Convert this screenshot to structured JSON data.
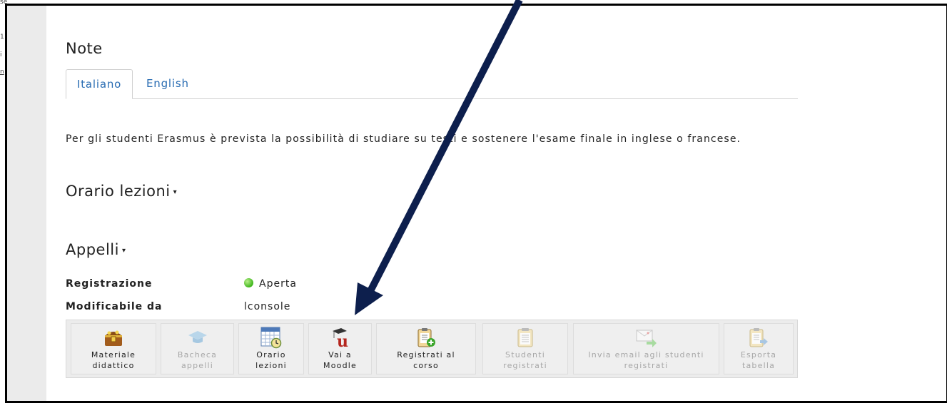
{
  "edge_fragments": [
    "se",
    "1",
    "i",
    "n"
  ],
  "note": {
    "title": "Note",
    "tabs": [
      {
        "label": "Italiano",
        "active": true
      },
      {
        "label": "English",
        "active": false
      }
    ],
    "text": "Per gli studenti Erasmus è prevista la possibilità di studiare su testi e sostenere l'esame finale in inglese o francese."
  },
  "orario": {
    "title": "Orario lezioni",
    "caret": "▾"
  },
  "appelli": {
    "title": "Appelli",
    "caret": "▾",
    "registrazione_label": "Registrazione",
    "registrazione_value": "Aperta",
    "registrazione_status_color": "#3eb51b",
    "modificabile_label": "Modificabile da",
    "modificabile_value": "lconsole"
  },
  "toolbar": {
    "buttons": [
      {
        "line1": "Materiale",
        "line2": "didattico",
        "icon": "treasure-chest-icon",
        "enabled": true
      },
      {
        "line1": "Bacheca",
        "line2": "appelli",
        "icon": "graduation-cap-icon",
        "enabled": false
      },
      {
        "line1": "Orario",
        "line2": "lezioni",
        "icon": "calendar-clock-icon",
        "enabled": true
      },
      {
        "line1": "Vai a",
        "line2": "Moodle",
        "icon": "moodle-icon",
        "enabled": true
      },
      {
        "line1": "Registrati al",
        "line2": "corso",
        "icon": "clipboard-add-icon",
        "enabled": true
      },
      {
        "line1": "Studenti",
        "line2": "registrati",
        "icon": "clipboard-list-icon",
        "enabled": false
      },
      {
        "line1": "Invia email agli studenti",
        "line2": "registrati",
        "icon": "email-forward-icon",
        "enabled": false
      },
      {
        "line1": "Esporta",
        "line2": "tabella",
        "icon": "clipboard-export-icon",
        "enabled": false
      }
    ]
  },
  "annotation": {
    "arrow_color": "#0d1f4d"
  }
}
